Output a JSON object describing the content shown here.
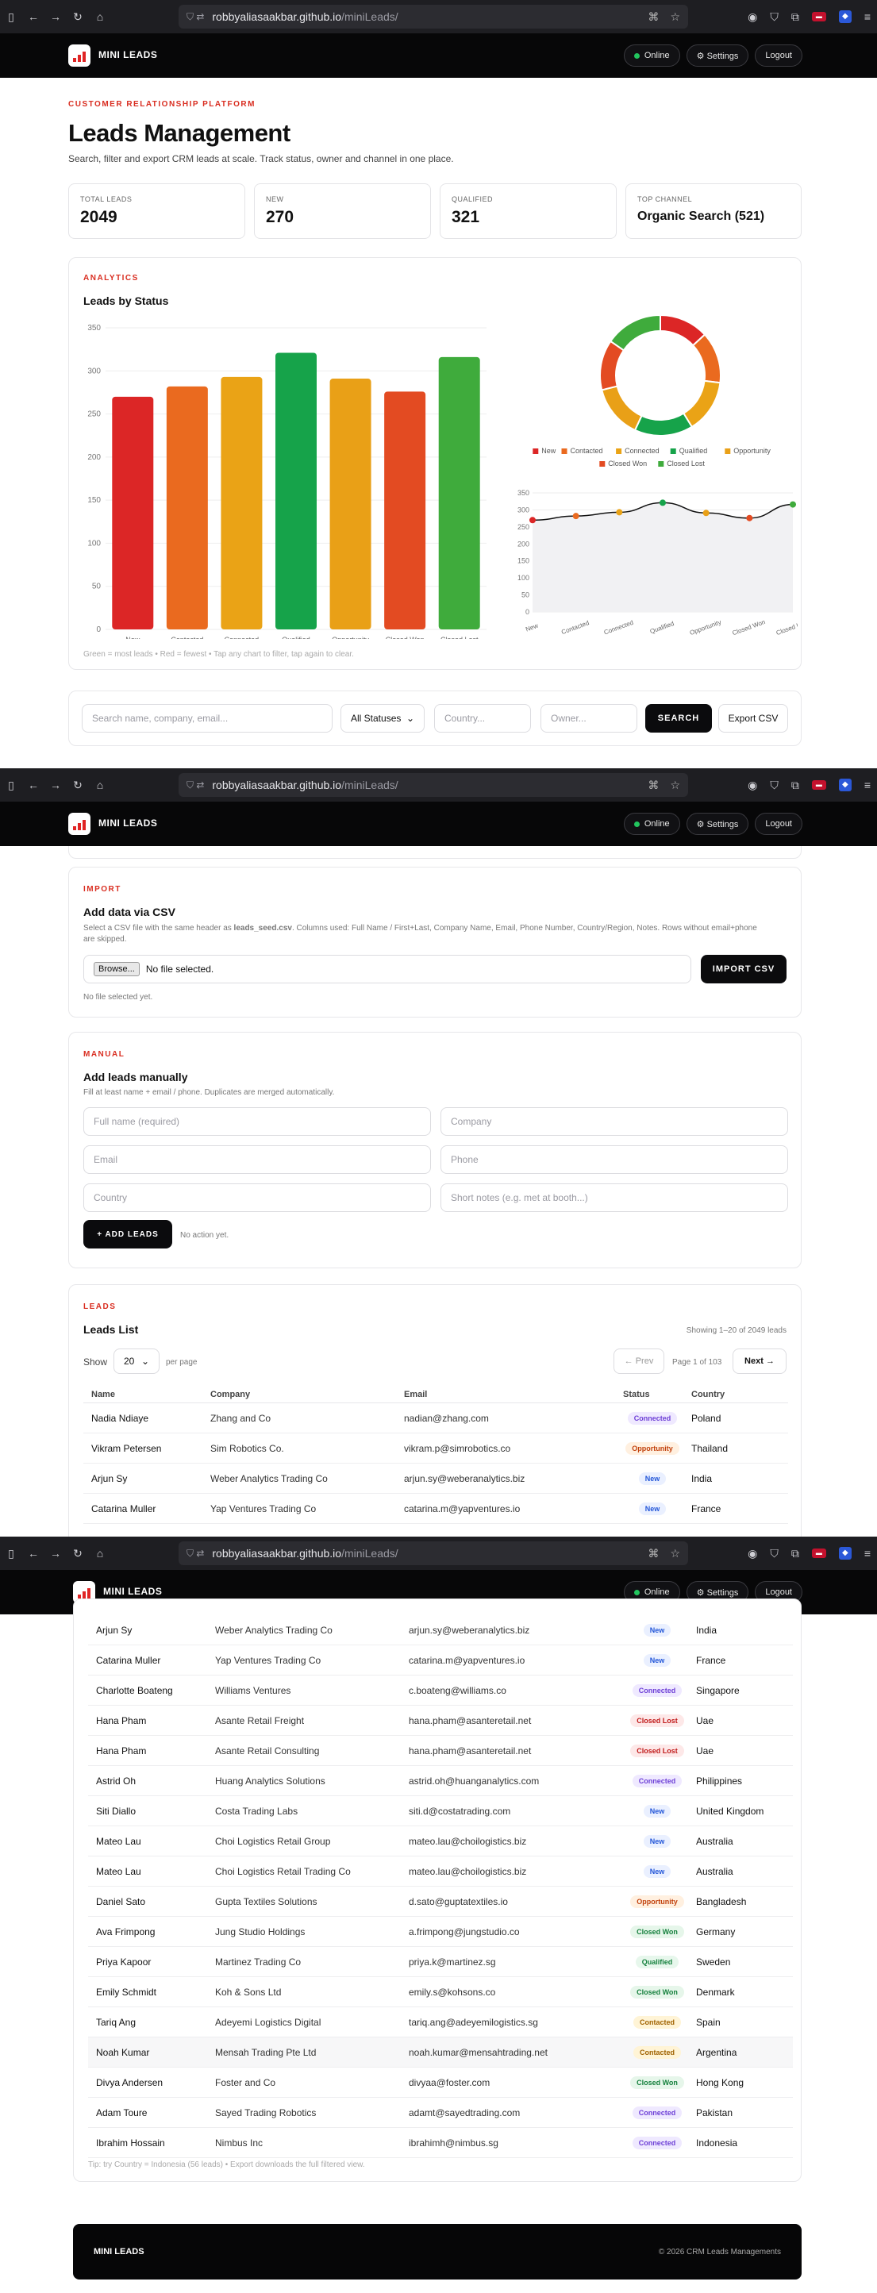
{
  "browser": {
    "url_host": "robbyaliasaakbar.github.io",
    "url_path": "/miniLeads/"
  },
  "nav": {
    "brand": "MINI LEADS",
    "online": "Online",
    "settings": "⚙ Settings",
    "logout": "Logout"
  },
  "hero": {
    "kicker": "CUSTOMER RELATIONSHIP PLATFORM",
    "title": "Leads Management",
    "subtitle": "Search, filter and export CRM leads at scale. Track status, owner and channel in one place."
  },
  "stats": [
    {
      "label": "TOTAL LEADS",
      "value": "2049"
    },
    {
      "label": "NEW",
      "value": "270"
    },
    {
      "label": "QUALIFIED",
      "value": "321"
    },
    {
      "label": "TOP CHANNEL",
      "value": "Organic Search (521)"
    }
  ],
  "analytics": {
    "kicker": "ANALYTICS",
    "title": "Leads by Status",
    "hint": "Green = most leads • Red = fewest • Tap any chart to filter, tap again to clear."
  },
  "chart_data": [
    {
      "type": "bar",
      "title": "Leads by Status",
      "categories": [
        "New",
        "Contacted",
        "Connected",
        "Qualified",
        "Opportunity",
        "Closed Won",
        "Closed Lost"
      ],
      "values": [
        270,
        282,
        293,
        321,
        291,
        276,
        316
      ],
      "colors": [
        "#dc2626",
        "#ea6a1f",
        "#eaa316",
        "#16a34a",
        "#e9a017",
        "#e34b22",
        "#3fab3c"
      ],
      "ylim": [
        0,
        350
      ],
      "yticks": [
        0,
        50,
        100,
        150,
        200,
        250,
        300,
        350
      ]
    },
    {
      "type": "pie",
      "categories": [
        "New",
        "Contacted",
        "Connected",
        "Qualified",
        "Opportunity",
        "Closed Won",
        "Closed Lost"
      ],
      "values": [
        270,
        282,
        293,
        321,
        291,
        276,
        316
      ],
      "colors": [
        "#dc2626",
        "#ea6a1f",
        "#eaa316",
        "#16a34a",
        "#e9a017",
        "#e34b22",
        "#3fab3c"
      ],
      "legend": [
        "New",
        "Contacted",
        "Connected",
        "Qualified",
        "Opportunity",
        "Closed Won",
        "Closed Lost"
      ]
    },
    {
      "type": "line",
      "categories": [
        "New",
        "Contacted",
        "Connected",
        "Qualified",
        "Opportunity",
        "Closed Won",
        "Closed Lost"
      ],
      "values": [
        270,
        282,
        293,
        321,
        291,
        276,
        316
      ],
      "ylim": [
        0,
        350
      ],
      "yticks": [
        0,
        50,
        100,
        150,
        200,
        250,
        300,
        350
      ]
    }
  ],
  "filters": {
    "search_placeholder": "Search name, company, email...",
    "status": "All Statuses",
    "country_placeholder": "Country...",
    "owner_placeholder": "Owner...",
    "search_btn": "SEARCH",
    "export_btn": "Export CSV"
  },
  "import": {
    "kicker": "IMPORT",
    "title": "Add data via CSV",
    "desc_pre": "Select a CSV file with the same header as ",
    "desc_file": "leads_seed.csv",
    "desc_post": ". Columns used: Full Name / First+Last, Company Name, Email, Phone Number, Country/Region, Notes. Rows without email+phone are skipped.",
    "browse": "Browse...",
    "no_file": "No file selected.",
    "button": "IMPORT CSV",
    "status": "No file selected yet."
  },
  "manual": {
    "kicker": "MANUAL",
    "title": "Add leads manually",
    "desc": "Fill at least name + email / phone. Duplicates are merged automatically.",
    "fullname": "Full name (required)",
    "company": "Company",
    "email": "Email",
    "phone": "Phone",
    "country": "Country",
    "notes": "Short notes (e.g. met at booth...)",
    "button": "+ ADD LEADS",
    "status": "No action yet."
  },
  "leads": {
    "kicker": "LEADS",
    "title": "Leads List",
    "showing": "Showing 1–20 of 2049 leads",
    "show": "Show",
    "per_page_value": "20",
    "per_page": "per page",
    "prev": "← Prev",
    "page": "Page 1 of 103",
    "next": "Next →",
    "headers": [
      "Name",
      "Company",
      "Email",
      "Status",
      "Country"
    ],
    "rows": [
      {
        "name": "Nadia Ndiaye",
        "company": "Zhang and Co",
        "email": "nadian@zhang.com",
        "status": "Connected",
        "country": "Poland"
      },
      {
        "name": "Vikram Petersen",
        "company": "Sim Robotics Co.",
        "email": "vikram.p@simrobotics.co",
        "status": "Opportunity",
        "country": "Thailand"
      },
      {
        "name": "Arjun Sy",
        "company": "Weber Analytics Trading Co",
        "email": "arjun.sy@weberanalytics.biz",
        "status": "New",
        "country": "India"
      },
      {
        "name": "Catarina Muller",
        "company": "Yap Ventures Trading Co",
        "email": "catarina.m@yapventures.io",
        "status": "New",
        "country": "France"
      }
    ],
    "rows2": [
      {
        "name": "Arjun Sy",
        "company": "Weber Analytics Trading Co",
        "email": "arjun.sy@weberanalytics.biz",
        "status": "New",
        "country": "India"
      },
      {
        "name": "Catarina Muller",
        "company": "Yap Ventures Trading Co",
        "email": "catarina.m@yapventures.io",
        "status": "New",
        "country": "France"
      },
      {
        "name": "Charlotte Boateng",
        "company": "Williams Ventures",
        "email": "c.boateng@williams.co",
        "status": "Connected",
        "country": "Singapore"
      },
      {
        "name": "Hana Pham",
        "company": "Asante Retail Freight",
        "email": "hana.pham@asanteretail.net",
        "status": "Closed Lost",
        "country": "Uae"
      },
      {
        "name": "Hana Pham",
        "company": "Asante Retail Consulting",
        "email": "hana.pham@asanteretail.net",
        "status": "Closed Lost",
        "country": "Uae"
      },
      {
        "name": "Astrid Oh",
        "company": "Huang Analytics Solutions",
        "email": "astrid.oh@huanganalytics.com",
        "status": "Connected",
        "country": "Philippines"
      },
      {
        "name": "Siti Diallo",
        "company": "Costa Trading Labs",
        "email": "siti.d@costatrading.com",
        "status": "New",
        "country": "United Kingdom"
      },
      {
        "name": "Mateo Lau",
        "company": "Choi Logistics Retail Group",
        "email": "mateo.lau@choilogistics.biz",
        "status": "New",
        "country": "Australia"
      },
      {
        "name": "Mateo Lau",
        "company": "Choi Logistics Retail Trading Co",
        "email": "mateo.lau@choilogistics.biz",
        "status": "New",
        "country": "Australia"
      },
      {
        "name": "Daniel Sato",
        "company": "Gupta Textiles Solutions",
        "email": "d.sato@guptatextiles.io",
        "status": "Opportunity",
        "country": "Bangladesh"
      },
      {
        "name": "Ava Frimpong",
        "company": "Jung Studio Holdings",
        "email": "a.frimpong@jungstudio.co",
        "status": "Closed Won",
        "country": "Germany"
      },
      {
        "name": "Priya Kapoor",
        "company": "Martinez Trading Co",
        "email": "priya.k@martinez.sg",
        "status": "Qualified",
        "country": "Sweden"
      },
      {
        "name": "Emily Schmidt",
        "company": "Koh & Sons Ltd",
        "email": "emily.s@kohsons.co",
        "status": "Closed Won",
        "country": "Denmark"
      },
      {
        "name": "Tariq Ang",
        "company": "Adeyemi Logistics Digital",
        "email": "tariq.ang@adeyemilogistics.sg",
        "status": "Contacted",
        "country": "Spain"
      },
      {
        "name": "Noah Kumar",
        "company": "Mensah Trading Pte Ltd",
        "email": "noah.kumar@mensahtrading.net",
        "status": "Contacted",
        "country": "Argentina"
      },
      {
        "name": "Divya Andersen",
        "company": "Foster and Co",
        "email": "divyaa@foster.com",
        "status": "Closed Won",
        "country": "Hong Kong"
      },
      {
        "name": "Adam Toure",
        "company": "Sayed Trading Robotics",
        "email": "adamt@sayedtrading.com",
        "status": "Connected",
        "country": "Pakistan"
      },
      {
        "name": "Ibrahim Hossain",
        "company": "Nimbus Inc",
        "email": "ibrahimh@nimbus.sg",
        "status": "Connected",
        "country": "Indonesia"
      }
    ],
    "tip": "Tip: try Country = Indonesia (56 leads) • Export downloads the full filtered view."
  },
  "footer": {
    "brand": "MINI LEADS",
    "copyright": "© 2026 CRM Leads Managements"
  }
}
